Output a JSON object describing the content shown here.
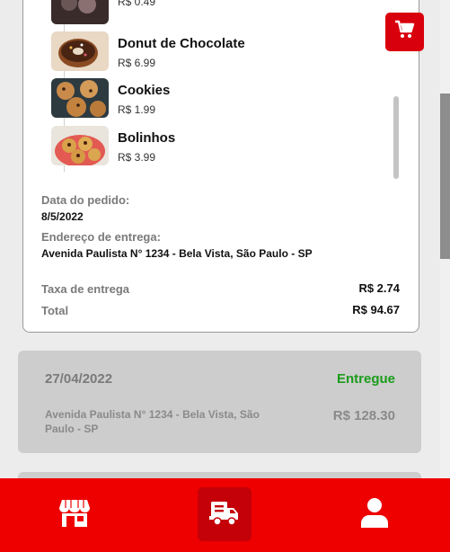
{
  "products": [
    {
      "name": "",
      "price": "R$ 0.49",
      "image": "food-photo"
    },
    {
      "name": "Donut de Chocolate",
      "price": "R$ 6.99",
      "image": "donut-photo"
    },
    {
      "name": "Cookies",
      "price": "R$ 1.99",
      "image": "cookies-photo"
    },
    {
      "name": "Bolinhos",
      "price": "R$ 3.99",
      "image": "muffins-photo"
    }
  ],
  "order_details": {
    "date_label": "Data do pedido:",
    "date_value": "8/5/2022",
    "address_label": "Endereço de entrega:",
    "address_value": "Avenida Paulista N° 1234 - Bela Vista, São Paulo - SP",
    "fee_label": "Taxa de entrega",
    "fee_value": "R$ 2.74",
    "total_label": "Total",
    "total_value": "R$ 94.67"
  },
  "cart_button": {
    "icon": "shopping-cart-icon",
    "color": "#d9000d"
  },
  "past_order": {
    "date": "27/04/2022",
    "status": "Entregue",
    "status_color": "#1a9c1a",
    "address": "Avenida Paulista N° 1234 - Bela Vista, São Paulo - SP",
    "total": "R$ 128.30"
  },
  "bottom_nav": {
    "items": [
      {
        "icon": "store-icon",
        "active": false
      },
      {
        "icon": "delivery-truck-icon",
        "active": true
      },
      {
        "icon": "user-profile-icon",
        "active": false
      }
    ],
    "color": "#ee0000",
    "active_color": "#c40008"
  }
}
